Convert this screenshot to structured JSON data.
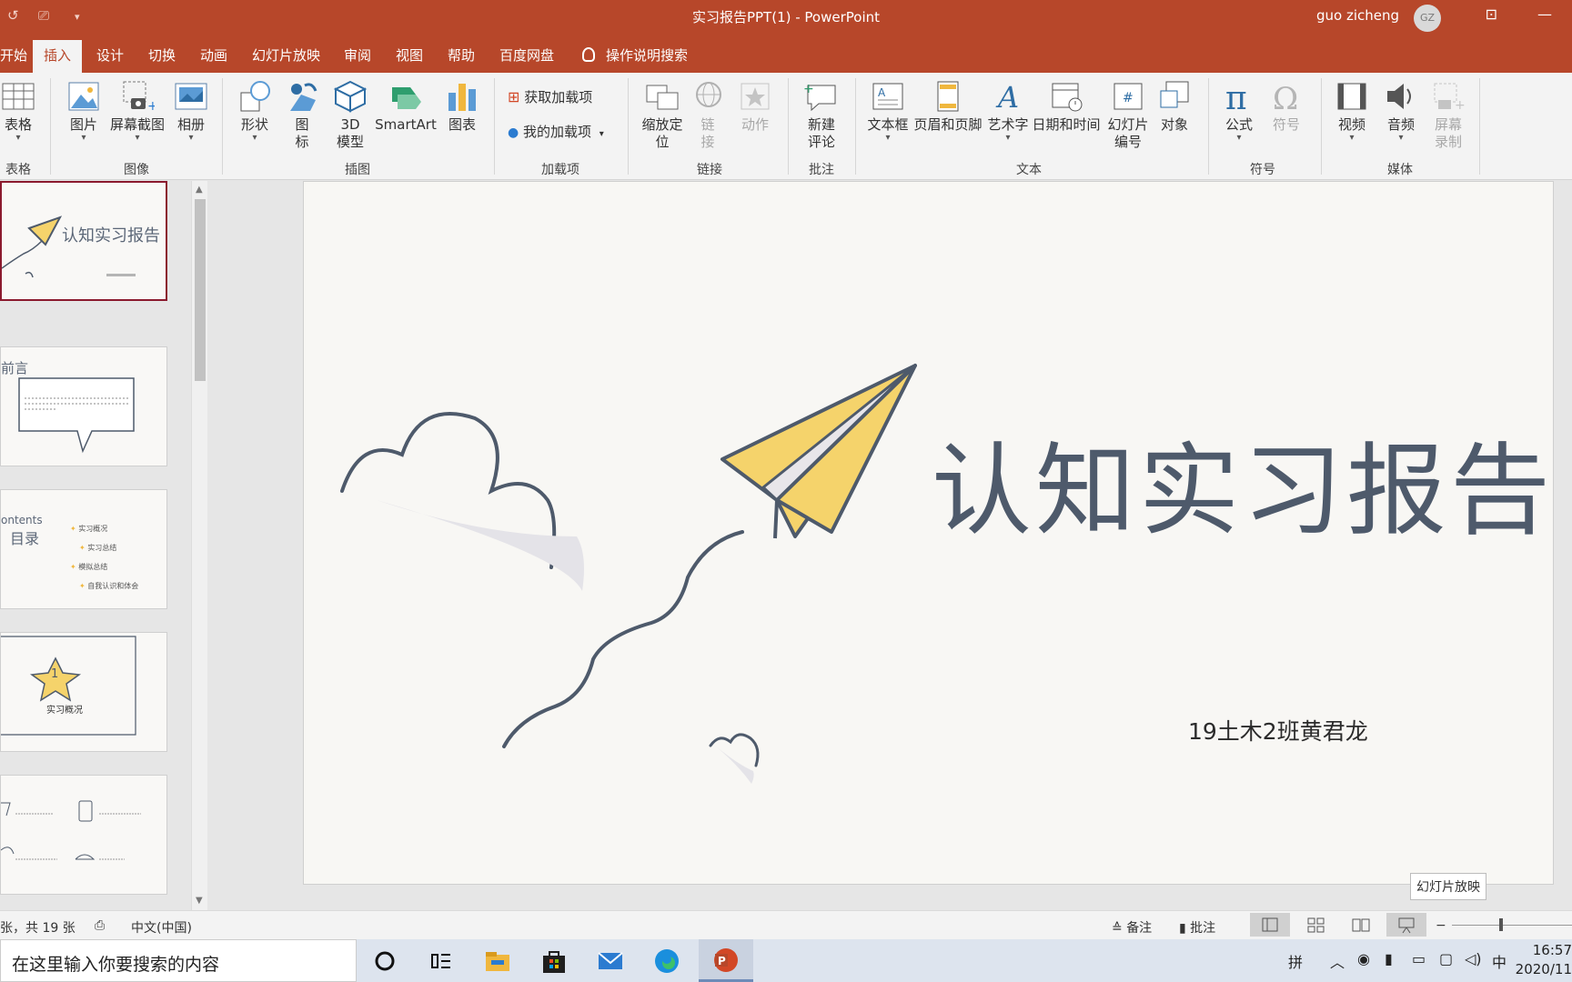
{
  "titlebar": {
    "title": "实习报告PPT(1)  -  PowerPoint",
    "user": "guo zicheng",
    "avatar_initials": "GZ",
    "accent": "#b7472a"
  },
  "tabs": [
    "开始",
    "插入",
    "设计",
    "切换",
    "动画",
    "幻灯片放映",
    "审阅",
    "视图",
    "帮助",
    "百度网盘"
  ],
  "active_tab": "插入",
  "tellme": "操作说明搜索",
  "ribbon": {
    "table": "表格",
    "group_table": "表格",
    "picture": "图片",
    "screenshot": "屏幕截图",
    "album": "相册",
    "group_image": "图像",
    "shapes": "形状",
    "icons": "图\n标",
    "model3d": "3D\n模型",
    "smartart": "SmartArt",
    "chart": "图表",
    "group_illus": "插图",
    "get_addins": "获取加载项",
    "my_addins": "我的加载项",
    "group_addins": "加载项",
    "zoom": "缩放定\n位",
    "link": "链\n接",
    "action": "动作",
    "group_links": "链接",
    "new_comment": "新建\n评论",
    "group_comments": "批注",
    "textbox": "文本框",
    "header_footer": "页眉和页脚",
    "wordart": "艺术字",
    "datetime": "日期和时间",
    "slide_number": "幻灯片\n编号",
    "object": "对象",
    "group_text": "文本",
    "equation": "公式",
    "symbol": "符号",
    "group_symbols": "符号",
    "video": "视频",
    "audio": "音频",
    "screen_record": "屏幕\n录制",
    "group_media": "媒体"
  },
  "thumbnails": {
    "t1_title": "认知实习报告",
    "t2_title": "前言",
    "t3_title": "ontents",
    "t3_sub": "目录",
    "t3_items": [
      "实习概况",
      "实习总结",
      "模拟总结",
      "自我认识和体会"
    ],
    "t4_num": "1",
    "t4_label": "实习概况"
  },
  "slide": {
    "title": "认知实习报告",
    "subtitle": "19土木2班黄君龙",
    "title_color": "#4e5a6b",
    "plane_color": "#f5d36b"
  },
  "tooltip": "幻灯片放映",
  "statusbar": {
    "slide_info": "张，共 19 张",
    "language": "中文(中国)",
    "notes": "备注",
    "comments": "批注"
  },
  "taskbar": {
    "search_placeholder": "在这里输入你要搜索的内容",
    "ime1": "拼",
    "ime2": "中",
    "time": "16:57",
    "date": "2020/11"
  }
}
